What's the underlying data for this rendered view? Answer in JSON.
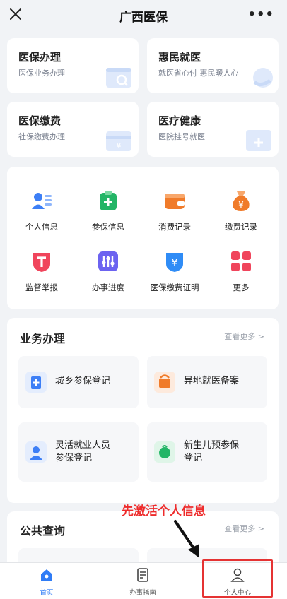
{
  "header": {
    "title": "广西医保",
    "more_label": "•••"
  },
  "quick_cards": [
    {
      "title": "医保办理",
      "subtitle": "医保业务办理"
    },
    {
      "title": "惠民就医",
      "subtitle": "就医省心付 惠民暖人心"
    },
    {
      "title": "医保缴费",
      "subtitle": "社保缴费办理"
    },
    {
      "title": "医疗健康",
      "subtitle": "医院挂号就医"
    }
  ],
  "grid": [
    {
      "label": "个人信息",
      "icon": "person-card-icon",
      "color": "#3d7ff6"
    },
    {
      "label": "参保信息",
      "icon": "clipboard-plus-icon",
      "color": "#23b566"
    },
    {
      "label": "消费记录",
      "icon": "wallet-icon",
      "color": "#f07b2a"
    },
    {
      "label": "缴费记录",
      "icon": "money-bag-icon",
      "color": "#f07b2a"
    },
    {
      "label": "监督举报",
      "icon": "shield-t-icon",
      "color": "#f0455c"
    },
    {
      "label": "办事进度",
      "icon": "sliders-icon",
      "color": "#6c63f0"
    },
    {
      "label": "医保缴费证明",
      "icon": "shield-yen-icon",
      "color": "#2f8cf6"
    },
    {
      "label": "更多",
      "icon": "grid-more-icon",
      "color": "#f0455c"
    }
  ],
  "business": {
    "title": "业务办理",
    "see_more": "查看更多 >",
    "items": [
      {
        "line1": "城乡参保登记",
        "line2": "",
        "icon": "register-plus-icon",
        "color": "#3d7ff6"
      },
      {
        "line1": "异地就医备案",
        "line2": "",
        "icon": "transfer-icon",
        "color": "#f07b2a"
      },
      {
        "line1": "灵活就业人员",
        "line2": "参保登记",
        "icon": "worker-icon",
        "color": "#3d7ff6"
      },
      {
        "line1": "新生儿预参保",
        "line2": "登记",
        "icon": "baby-icon",
        "color": "#23b566"
      }
    ]
  },
  "public_query": {
    "title": "公共查询",
    "see_more": "查看更多 >"
  },
  "annotation": "先激活个人信息",
  "tabbar": [
    {
      "label": "首页",
      "icon": "home-icon",
      "active": true
    },
    {
      "label": "办事指南",
      "icon": "document-icon",
      "active": false
    },
    {
      "label": "个人中心",
      "icon": "user-icon",
      "active": false
    }
  ]
}
